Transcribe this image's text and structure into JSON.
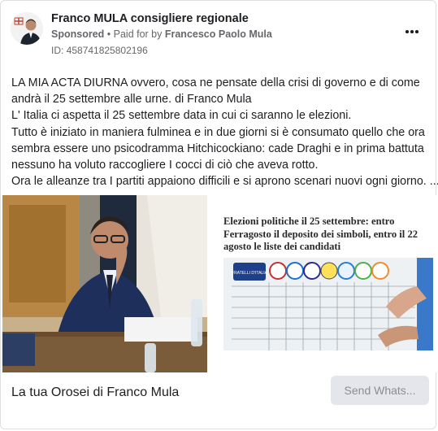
{
  "header": {
    "page_name": "Franco MULA consigliere regionale",
    "sponsored": "Sponsored",
    "separator": " • ",
    "paid_for_prefix": "Paid for by ",
    "payer": "Francesco Paolo Mula",
    "ad_id": "ID: 458741825802196"
  },
  "body": {
    "lines": [
      "LA MIA ACTA DIURNA ovvero, cosa ne pensate della crisi di governo e di come",
      "andrà il 25 settembre alle urne. di Franco Mula",
      "L' Italia ci aspetta il 25 settembre data in cui ci saranno le elezioni.",
      "Tutto è iniziato in maniera fulminea e in due giorni si è consumato quello che ora",
      "sembra essere uno psicodramma Hitchicockiano: cade Draghi e in prima battuta",
      "nessuno ha voluto raccogliere I cocci di ciò che aveva rotto.",
      "Ora le alleanze tra I partiti appaiono difficili e si aprono scenari nuovi ogni giorno. ..."
    ]
  },
  "media": {
    "right_headline_lines": [
      "Elezioni politiche il 25 settembre: entro",
      "Ferragosto il deposito dei simboli, entro il 22",
      "agosto le liste dei candidati"
    ],
    "poster_label": "FRATELLI D'ITALIA"
  },
  "footer": {
    "title": "La tua Orosei di Franco Mula",
    "cta_label": "Send Whats..."
  },
  "icons": {
    "more": "more-horizontal-icon"
  }
}
